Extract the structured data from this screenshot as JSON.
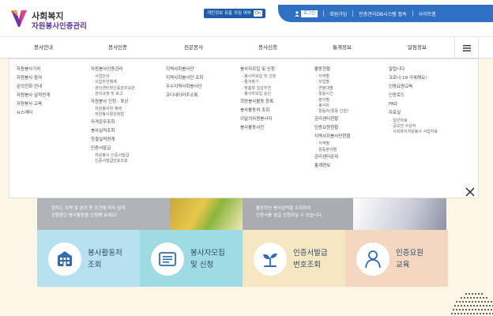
{
  "header": {
    "logo_line1": "사회복지",
    "logo_line2": "자원봉사인증관리",
    "consent_label": "개인정보 유출 의심 여부",
    "consent_state": "On",
    "util": {
      "login": "로그인",
      "join": "회원가입",
      "idb": "인증관리DB시스템 접속",
      "sitemap": "사이트맵"
    }
  },
  "nav": {
    "items": [
      "봉사안내",
      "봉사인증",
      "전문봉사",
      "봉사신청",
      "통계정보",
      "알림정보"
    ]
  },
  "mega": {
    "col1": [
      "자원봉사가치",
      "자원봉사 참여",
      "문의전화 안내",
      "자원봉사 실적연계",
      "자원봉사 교육",
      "뉴스레터"
    ],
    "col2": [
      {
        "t": "자원봉사인증관리"
      },
      {
        "s": "· 사업안내"
      },
      {
        "s": "· 사업추진체계"
      },
      {
        "s": "· 관리센터및인증관리요원"
      },
      {
        "s": "· 관리규정 및 로고"
      },
      {
        "t": "자원봉사 인정 · 포상"
      },
      {
        "s": "· 자원봉사자 혜택"
      },
      {
        "s": "· 자원봉사활성화법"
      },
      {
        "t": "자격운무조회"
      },
      {
        "t": "봉사실적조회"
      },
      {
        "t": "한결실적연계"
      },
      {
        "t": "인증서발급"
      },
      {
        "s": "· 자원봉사 인증서발급"
      },
      {
        "s": "· 인증서발급번호조회"
      }
    ],
    "col3": [
      "지역사회봉사단",
      "지역사회봉사단 조회",
      "우수지역사회봉사단",
      "코디네이터주소록"
    ],
    "col4": [
      {
        "t": "봉사자모집 및 신청"
      },
      {
        "s": "· 봉사자모집 및 신청"
      },
      {
        "s": "· 즐겨찾기"
      },
      {
        "s": "· 맞춤형 일감추천"
      },
      {
        "s": "· 봉사자모집 승인"
      },
      {
        "t": "희망봉사활동 등록"
      },
      {
        "t": "봉사활동처 조회"
      },
      {
        "t": "이달의자원봉사자"
      },
      {
        "t": "봉사활동사진"
      }
    ],
    "col5": [
      {
        "t": "활동현황"
      },
      {
        "s": "· 지역별"
      },
      {
        "s": "· 직업별"
      },
      {
        "s": "· 연령대별"
      },
      {
        "s": "· 활동시간"
      },
      {
        "s": "· 분야별"
      },
      {
        "s": "· 봉사자"
      },
      {
        "s": "· 활동자(활동 인원)"
      },
      {
        "t": "관리센터현황"
      },
      {
        "t": "인증요원현황"
      },
      {
        "t": "지역사회봉사단현황"
      },
      {
        "s": "· 지역별"
      },
      {
        "s": "· 활동분야별"
      },
      {
        "t": "관리센터순위"
      },
      {
        "t": "통계연보"
      }
    ],
    "col6": [
      {
        "t": "알립니다"
      },
      {
        "t": "코로나-19 극복해요!"
      },
      {
        "t": "인증요원교육"
      },
      {
        "t": "인증로드"
      },
      {
        "t": "FAQ"
      },
      {
        "t": "자료실"
      },
      {
        "s": "· 일반자료"
      },
      {
        "s": "· 공모전 수상작"
      },
      {
        "s": "· 사회복지자원봉사 사업자료"
      }
    ]
  },
  "banner": {
    "left_line1": "원하는 지역 및 분야 등 조건에 따라 쉽게",
    "left_line2": "진행중인 봉사활동을 신청해 보세요!",
    "right_line1": "활동하신 봉사실적을 조회하여",
    "right_line2": "인증서를 발급 신청하실 수 있습니다."
  },
  "tiles": [
    {
      "label": "봉사활동처\n조회",
      "color": "#b8e1ef",
      "icon": "building-icon"
    },
    {
      "label": "봉사자모집\n및 신청",
      "color": "#9fdbe3",
      "icon": "list-board-icon"
    },
    {
      "label": "인증서발급\n번호조회",
      "color": "#f5e7c2",
      "icon": "sprout-icon"
    },
    {
      "label": "인증요원\n교육",
      "color": "#f4d7c1",
      "icon": "person-icon"
    }
  ]
}
